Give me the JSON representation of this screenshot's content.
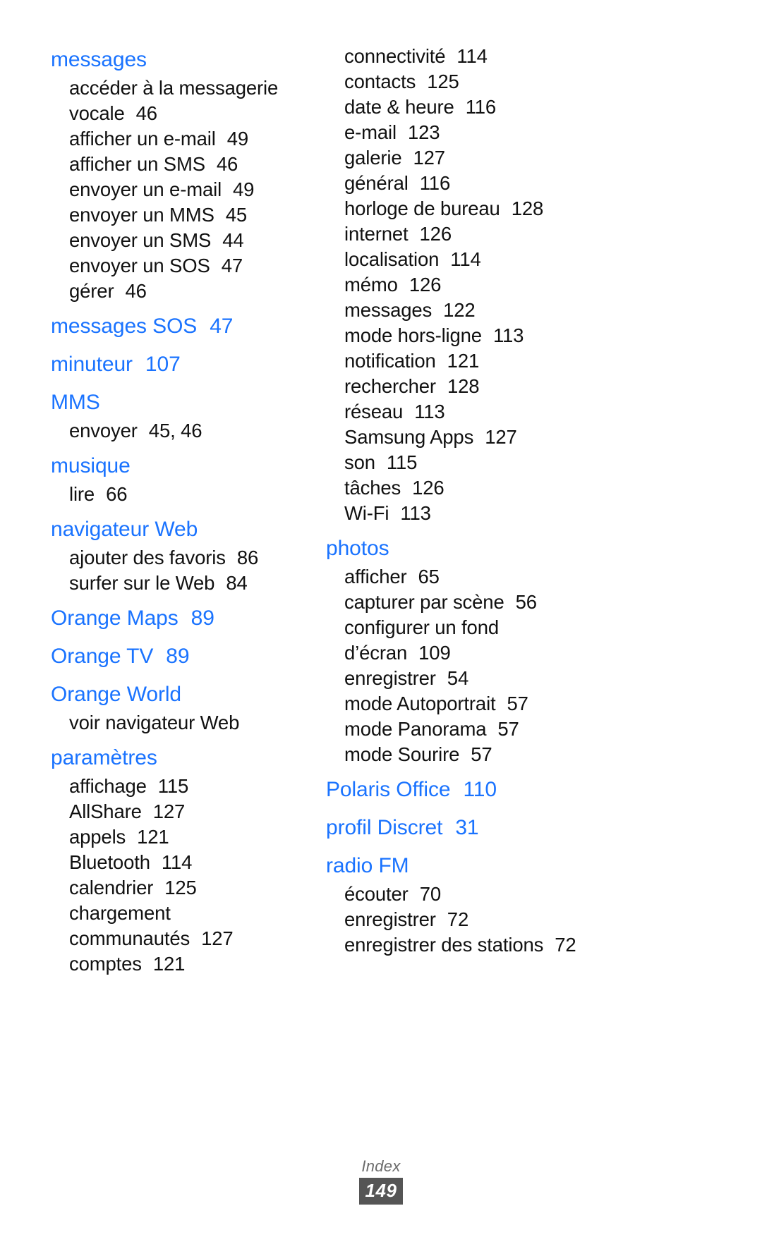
{
  "page": {
    "footer_label": "Index",
    "page_number": "149",
    "accent_color": "#1a73ff",
    "sub_color": "#111111",
    "badge_color": "#555555"
  },
  "left_column": [
    {
      "type": "main",
      "label": "messages",
      "page": "",
      "subs": [
        {
          "label": "accéder à la messagerie",
          "page": ""
        },
        {
          "label": "vocale",
          "page": "46"
        },
        {
          "label": "afficher un e-mail",
          "page": "49"
        },
        {
          "label": "afficher un SMS",
          "page": "46"
        },
        {
          "label": "envoyer un e-mail",
          "page": "49"
        },
        {
          "label": "envoyer un MMS",
          "page": "45"
        },
        {
          "label": "envoyer un SMS",
          "page": "44"
        },
        {
          "label": "envoyer un SOS",
          "page": "47"
        },
        {
          "label": "gérer",
          "page": "46"
        }
      ]
    },
    {
      "type": "main",
      "label": "messages SOS",
      "page": "47",
      "subs": []
    },
    {
      "type": "main",
      "label": "minuteur",
      "page": "107",
      "subs": []
    },
    {
      "type": "main",
      "label": "MMS",
      "page": "",
      "subs": [
        {
          "label": "envoyer",
          "page": "45, 46"
        }
      ]
    },
    {
      "type": "main",
      "label": "musique",
      "page": "",
      "subs": [
        {
          "label": "lire",
          "page": "66"
        }
      ]
    },
    {
      "type": "main",
      "label": "navigateur Web",
      "page": "",
      "subs": [
        {
          "label": "ajouter des favoris",
          "page": "86"
        },
        {
          "label": "surfer sur le Web",
          "page": "84"
        }
      ]
    },
    {
      "type": "main",
      "label": "Orange Maps",
      "page": "89",
      "subs": []
    },
    {
      "type": "main",
      "label": "Orange TV",
      "page": "89",
      "subs": []
    },
    {
      "type": "main",
      "label": "Orange World",
      "page": "",
      "subs": [
        {
          "label": "voir navigateur Web",
          "page": ""
        }
      ]
    },
    {
      "type": "main",
      "label": "paramètres",
      "page": "",
      "subs": [
        {
          "label": "affichage",
          "page": "115"
        },
        {
          "label": "AllShare",
          "page": "127"
        },
        {
          "label": "appels",
          "page": "121"
        },
        {
          "label": "Bluetooth",
          "page": "114"
        },
        {
          "label": "calendrier",
          "page": "125"
        },
        {
          "label": "chargement",
          "page": ""
        },
        {
          "label": "communautés",
          "page": "127"
        },
        {
          "label": "comptes",
          "page": "121"
        }
      ]
    }
  ],
  "right_column": [
    {
      "type": "continuation",
      "label": "",
      "page": "",
      "subs": [
        {
          "label": "connectivité",
          "page": "114"
        },
        {
          "label": "contacts",
          "page": "125"
        },
        {
          "label": "date & heure",
          "page": "116"
        },
        {
          "label": "e-mail",
          "page": "123"
        },
        {
          "label": "galerie",
          "page": "127"
        },
        {
          "label": "général",
          "page": "116"
        },
        {
          "label": "horloge de bureau",
          "page": "128"
        },
        {
          "label": "internet",
          "page": "126"
        },
        {
          "label": "localisation",
          "page": "114"
        },
        {
          "label": "mémo",
          "page": "126"
        },
        {
          "label": "messages",
          "page": "122"
        },
        {
          "label": "mode hors-ligne",
          "page": "113"
        },
        {
          "label": "notification",
          "page": "121"
        },
        {
          "label": "rechercher",
          "page": "128"
        },
        {
          "label": "réseau",
          "page": "113"
        },
        {
          "label": "Samsung Apps",
          "page": "127"
        },
        {
          "label": "son",
          "page": "115"
        },
        {
          "label": "tâches",
          "page": "126"
        },
        {
          "label": "Wi-Fi",
          "page": "113"
        }
      ]
    },
    {
      "type": "main",
      "label": "photos",
      "page": "",
      "subs": [
        {
          "label": "afficher",
          "page": "65"
        },
        {
          "label": "capturer par scène",
          "page": "56"
        },
        {
          "label": "configurer un fond",
          "page": ""
        },
        {
          "label": "d’écran",
          "page": "109"
        },
        {
          "label": "enregistrer",
          "page": "54"
        },
        {
          "label": "mode Autoportrait",
          "page": "57"
        },
        {
          "label": "mode Panorama",
          "page": "57"
        },
        {
          "label": "mode Sourire",
          "page": "57"
        }
      ]
    },
    {
      "type": "main",
      "label": "Polaris Office",
      "page": "110",
      "subs": []
    },
    {
      "type": "main",
      "label": "profil Discret",
      "page": "31",
      "subs": []
    },
    {
      "type": "main",
      "label": "radio FM",
      "page": "",
      "subs": [
        {
          "label": "écouter",
          "page": "70"
        },
        {
          "label": "enregistrer",
          "page": "72"
        },
        {
          "label": "enregistrer des stations",
          "page": "72"
        }
      ]
    }
  ]
}
